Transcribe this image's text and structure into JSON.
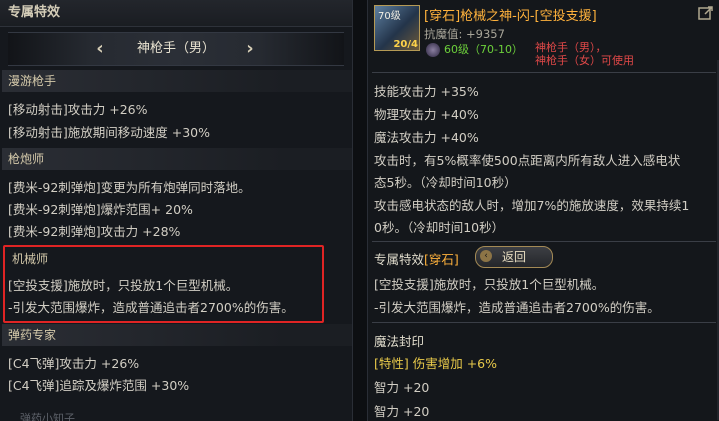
{
  "left": {
    "header_title": "专属特效",
    "selector": {
      "prev_arrow": "‹",
      "class_name": "神枪手（男）",
      "next_arrow": "›"
    },
    "sections": [
      {
        "title": "漫游枪手",
        "lines": [
          "[移动射击]攻击力 +26%",
          "[移动射击]施放期间移动速度 +30%"
        ]
      },
      {
        "title": "枪炮师",
        "lines": [
          "[费米-92刺弹炮]变更为所有炮弹同时落地。",
          "[费米-92刺弹炮]爆炸范围+ 20%",
          "[费米-92刺弹炮]攻击力 +28%"
        ]
      },
      {
        "title": "机械师",
        "lines": [
          "[空投支援]施放时，只投放1个巨型机械。",
          "-引发大范围爆炸，造成普通追击者2700%的伤害。"
        ]
      },
      {
        "title": "弹药专家",
        "lines": [
          "[C4飞弹]攻击力 +26%",
          "[C4飞弹]追踪及爆炸范围 +30%"
        ]
      }
    ],
    "footer_faded": "弹药小知子"
  },
  "right": {
    "item": {
      "level": "70级",
      "count": "20/4",
      "title": "[穿石]枪械之神-闪-[空投支援]",
      "resist": "抗魔值: +9357",
      "level_req": "60级（70-10）",
      "class_req_1": "神枪手（男），",
      "class_req_2": "神枪手（女）可使用"
    },
    "stats": [
      "技能攻击力 +35%",
      "物理攻击力 +40%",
      "魔法攻击力 +40%"
    ],
    "effect_desc": [
      "攻击时，有5%概率使500点距离内所有敌人进入感电状",
      "态5秒。（冷却时间10秒）",
      "攻击感电状态的敌人时，增加7%的施放速度，效果持续1",
      "0秒。（冷却时间10秒）"
    ],
    "exclusive": {
      "title": "专属特效",
      "tag": "[穿石]",
      "back_label": "返回",
      "lines": [
        "[空投支援]施放时，只投放1个巨型机械。",
        "-引发大范围爆炸，造成普通追击者2700%的伤害。"
      ]
    },
    "seal": {
      "title": "魔法封印",
      "lines": [
        "[特性] 伤害增加 +6%",
        "智力 +20",
        "智力 +20"
      ]
    }
  }
}
